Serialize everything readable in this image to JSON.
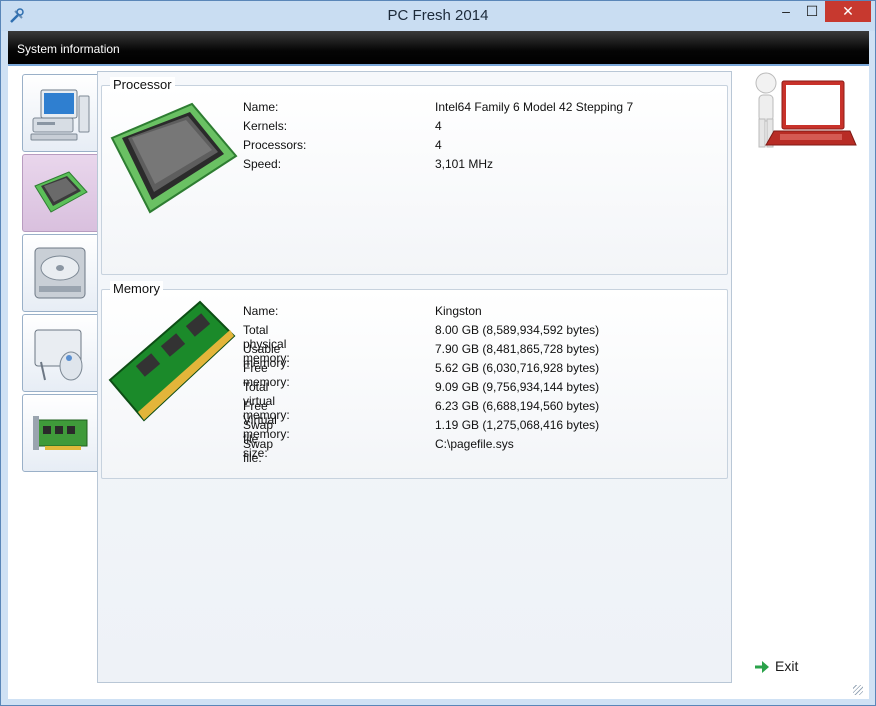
{
  "window": {
    "title": "PC Fresh 2014",
    "min_glyph": "–",
    "max_glyph": "☐",
    "close_glyph": "✕"
  },
  "section": {
    "title": "System information"
  },
  "nav": [
    {
      "name": "computer",
      "icon": "computer-icon"
    },
    {
      "name": "processor",
      "icon": "cpu-chip-icon",
      "active": true
    },
    {
      "name": "drive",
      "icon": "hard-drive-icon"
    },
    {
      "name": "display",
      "icon": "display-tablet-icon"
    },
    {
      "name": "card",
      "icon": "expansion-card-icon"
    }
  ],
  "processor": {
    "title": "Processor",
    "rows": [
      {
        "label": "Name:",
        "value": "Intel64 Family 6 Model 42 Stepping 7"
      },
      {
        "label": "Kernels:",
        "value": "4"
      },
      {
        "label": "Processors:",
        "value": "4"
      },
      {
        "label": "Speed:",
        "value": "3,101 MHz"
      }
    ]
  },
  "memory": {
    "title": "Memory",
    "rows": [
      {
        "label": "Name:",
        "value": "Kingston"
      },
      {
        "label": "Total physical memory:",
        "value": "8.00 GB (8,589,934,592 bytes)"
      },
      {
        "label": "Usable memory:",
        "value": "7.90 GB (8,481,865,728 bytes)"
      },
      {
        "label": "Free memory:",
        "value": "5.62 GB (6,030,716,928 bytes)"
      },
      {
        "label": "Total virtual memory:",
        "value": "9.09 GB (9,756,934,144 bytes)"
      },
      {
        "label": "Free Virtual memory:",
        "value": "6.23 GB (6,688,194,560 bytes)"
      },
      {
        "label": "Swap file size:",
        "value": "1.19 GB (1,275,068,416 bytes)"
      },
      {
        "label": "Swap file:",
        "value": "C:\\pagefile.sys"
      }
    ]
  },
  "actions": {
    "exit_label": "Exit"
  },
  "colors": {
    "accent": "#c7392f",
    "section_bar": "#000000",
    "active_tab": "#e3cde7",
    "exit_arrow": "#2aa24a"
  }
}
